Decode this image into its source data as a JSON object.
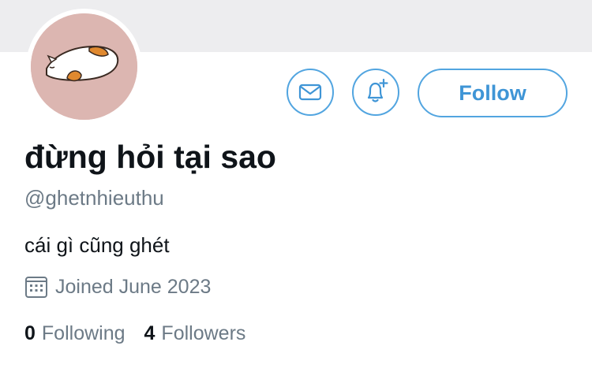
{
  "profile": {
    "display_name": "đừng hỏi tại sao",
    "handle": "@ghetnhieuthu",
    "bio": "cái gì cũng ghét",
    "joined": "Joined June 2023",
    "avatar_icon": "cat-loaf-avatar"
  },
  "actions": {
    "message_icon": "mail-icon",
    "notify_icon": "bell-plus-icon",
    "follow_label": "Follow"
  },
  "stats": {
    "following_count": "0",
    "following_label": "Following",
    "followers_count": "4",
    "followers_label": "Followers"
  },
  "colors": {
    "accent": "#52a5e0",
    "banner": "#ededef",
    "secondary_text": "#6c7a86",
    "primary_text": "#0f1419",
    "avatar_bg": "#dcb6b1"
  }
}
